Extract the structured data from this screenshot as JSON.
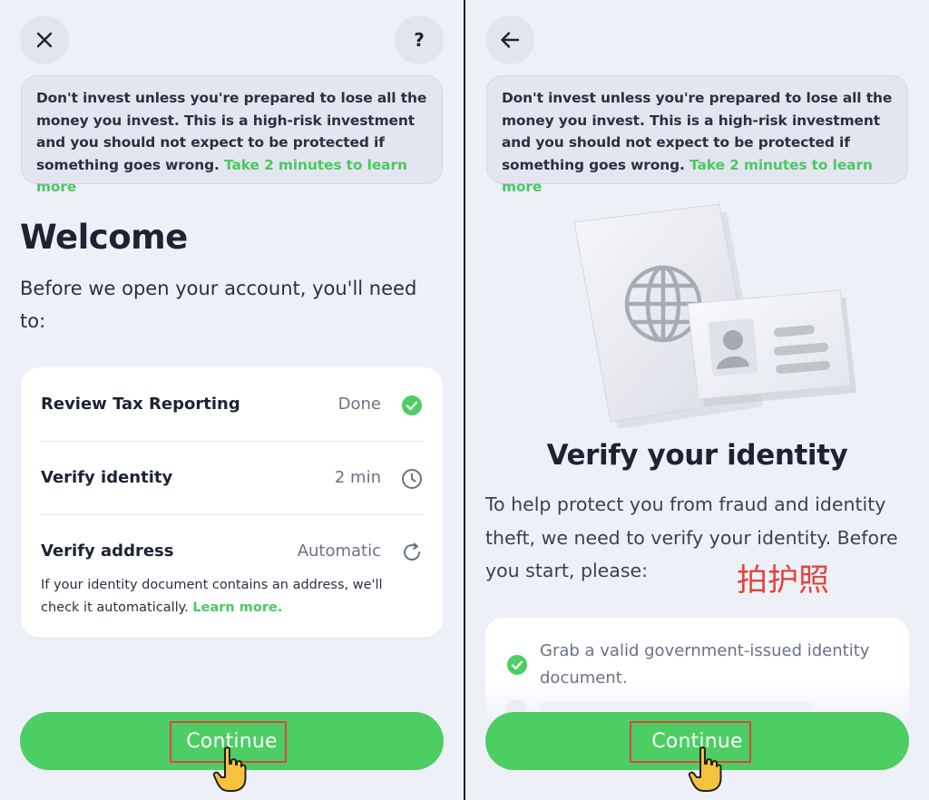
{
  "warning": {
    "text": "Don't invest unless you're prepared to lose all the money you invest. This is a high-risk investment and you should not expect to be protected if something goes wrong.",
    "link": "Take 2 minutes to learn more"
  },
  "left_screen": {
    "close_icon": "close-icon",
    "help_label": "?",
    "title": "Welcome",
    "subtitle": "Before we open your account, you'll need to:",
    "tasks": [
      {
        "name": "Review Tax Reporting",
        "status": "Done",
        "icon": "check-circle-icon"
      },
      {
        "name": "Verify identity",
        "status": "2 min",
        "icon": "clock-icon"
      },
      {
        "name": "Verify address",
        "status": "Automatic",
        "icon": "refresh-icon"
      }
    ],
    "address_note": "If your identity document contains an address, we'll check it automatically.",
    "address_link": "Learn more.",
    "continue_label": "Continue"
  },
  "right_screen": {
    "back_icon": "arrow-left-icon",
    "title": "Verify your identity",
    "description": "To help protect you from fraud and identity theft, we need to verify your identity. Before you start, please:",
    "annotation": "拍护照",
    "requirements": [
      "Grab a valid government-issued identity document."
    ],
    "continue_label": "Continue"
  },
  "colors": {
    "accent_green": "#4cce62",
    "link_green": "#4cc862",
    "highlight_red": "#e0453b",
    "background": "#eef0f8"
  }
}
